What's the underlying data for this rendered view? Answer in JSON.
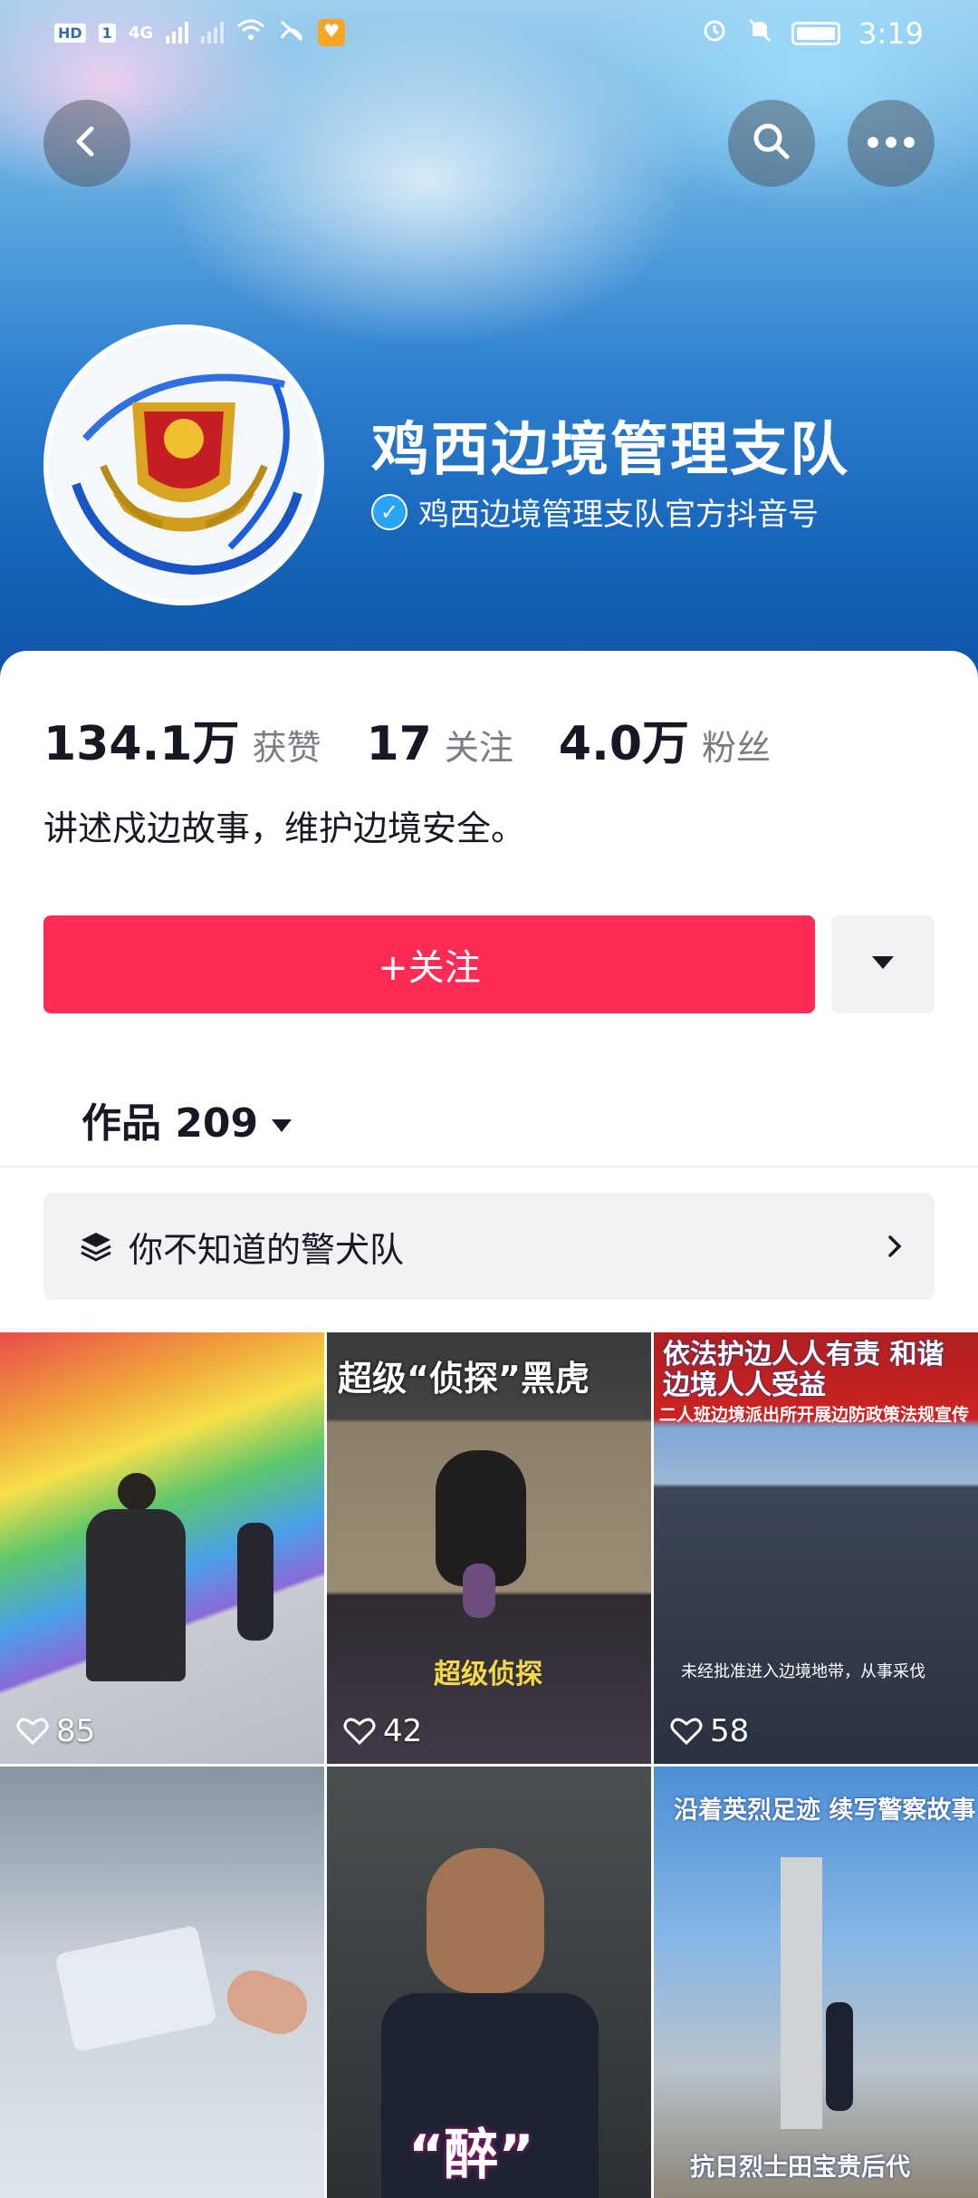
{
  "status_bar": {
    "left": [
      "HD",
      "1",
      "4G"
    ],
    "time": "3:19"
  },
  "header": {
    "back_icon": "chevron-left-icon",
    "search_icon": "search-icon",
    "more_icon": "more-horizontal-icon"
  },
  "profile": {
    "name": "鸡西边境管理支队",
    "verified_text": "鸡西边境管理支队官方抖音号",
    "bio": "讲述戍边故事，维护边境安全。",
    "stats": [
      {
        "value": "134.1万",
        "label": "获赞"
      },
      {
        "value": "17",
        "label": "关注"
      },
      {
        "value": "4.0万",
        "label": "粉丝"
      }
    ]
  },
  "actions": {
    "follow_label": "+关注"
  },
  "tabs": {
    "works_label": "作品 209"
  },
  "collection": {
    "label": "你不知道的警犬队"
  },
  "videos": [
    {
      "likes": "85",
      "overlay_top": "",
      "overlay_bottom": ""
    },
    {
      "likes": "42",
      "overlay_top": "超级“侦探”黑虎",
      "overlay_bottom": "超级侦探"
    },
    {
      "likes": "58",
      "overlay_top": "依法护边人人有责 和谐边境人人受益",
      "overlay_mid": "二人班边境派出所开展边防政策法规宣传",
      "overlay_bottom": "未经批准进入边境地带，从事采伐"
    },
    {
      "likes": "",
      "overlay_top": "",
      "overlay_bottom": ""
    },
    {
      "likes": "",
      "overlay_top": "",
      "overlay_bottom": "“醉”"
    },
    {
      "likes": "",
      "overlay_top": "沿着英烈足迹 续写警察故事",
      "overlay_bottom": "抗日烈士田宝贵后代"
    }
  ],
  "colors": {
    "accent": "#fe2c55",
    "header_blue": "#1664bb"
  }
}
